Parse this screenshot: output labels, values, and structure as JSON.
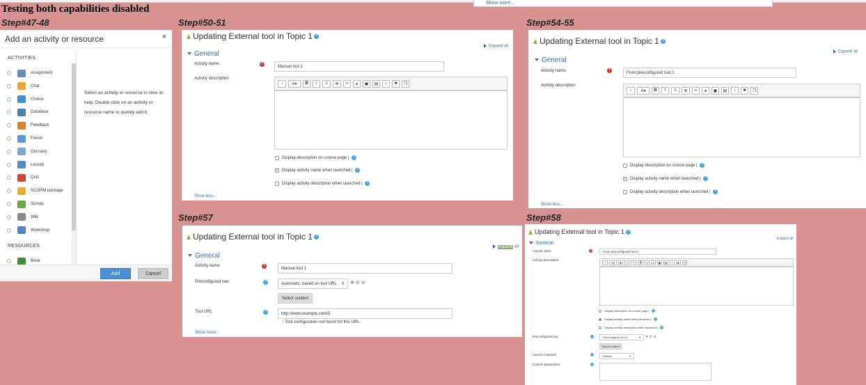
{
  "page_title": "Testing both capabilities disabled",
  "top_show_more": "Show more...",
  "steps": {
    "s1": "Step#47-48",
    "s2": "Step#50-51",
    "s3": "Step#54-55",
    "s4": "Step#57",
    "s5": "Step#58"
  },
  "chooser": {
    "title": "Add an activity or resource",
    "close": "×",
    "group_activities": "ACTIVITIES",
    "group_resources": "RESOURCES",
    "items": [
      {
        "label": "Assignment",
        "color": "#6b8cba"
      },
      {
        "label": "Chat",
        "color": "#e8a53a"
      },
      {
        "label": "Choice",
        "color": "#3d8fd1"
      },
      {
        "label": "Database",
        "color": "#4a7fb5"
      },
      {
        "label": "Feedback",
        "color": "#d9822b"
      },
      {
        "label": "Forum",
        "color": "#5b9bd5"
      },
      {
        "label": "Glossary",
        "color": "#7fa7d4"
      },
      {
        "label": "Lesson",
        "color": "#4d8cc7"
      },
      {
        "label": "Quiz",
        "color": "#c9473b"
      },
      {
        "label": "SCORM package",
        "color": "#e7b12f"
      },
      {
        "label": "Survey",
        "color": "#6aa84f"
      },
      {
        "label": "Wiki",
        "color": "#888888"
      },
      {
        "label": "Workshop",
        "color": "#4f86c6"
      }
    ],
    "resource_items": [
      {
        "label": "Book",
        "color": "#3e8e41"
      }
    ],
    "help_text": "Select an activity or resource to view its help. Double-click on an activity or resource name to quickly add it.",
    "add_label": "Add",
    "cancel_label": "Cancel"
  },
  "form_common": {
    "heading": "Updating External tool in Topic 1",
    "expand_all": "Expand all",
    "general": "General",
    "activity_name_label": "Activity name",
    "activity_description_label": "Activity description",
    "display_desc": "Display description on course page",
    "display_name": "Display activity name when launched",
    "display_act_desc": "Display activity description when launched",
    "show_less": "Show less...",
    "show_more": "Show more...",
    "preconfigured_tool_label": "Preconfigured tool",
    "select_content": "Select content",
    "tool_url_label": "Tool URL",
    "launch_container_label": "Launch container",
    "custom_parameters_label": "Custom parameters",
    "exclaim": "!"
  },
  "form_a": {
    "activity_name_value": "Manual tool 1"
  },
  "form_b": {
    "activity_name_value": "From preconfigured tool 1"
  },
  "form_c": {
    "activity_name_value": "Manual tool 1",
    "preconfigured_value": "Automatic, based on tool URL",
    "tool_url_value": "http://www.example.com/5",
    "tool_url_warning": "Tool configuration not found for this URL.",
    "expand_label": "Expand",
    "expand_all_suffix": "all"
  },
  "form_d": {
    "activity_name_value": "From preconfigured tool 1",
    "preconfigured_value": "Preconfigured tool 1",
    "launch_container_value": "Default"
  }
}
